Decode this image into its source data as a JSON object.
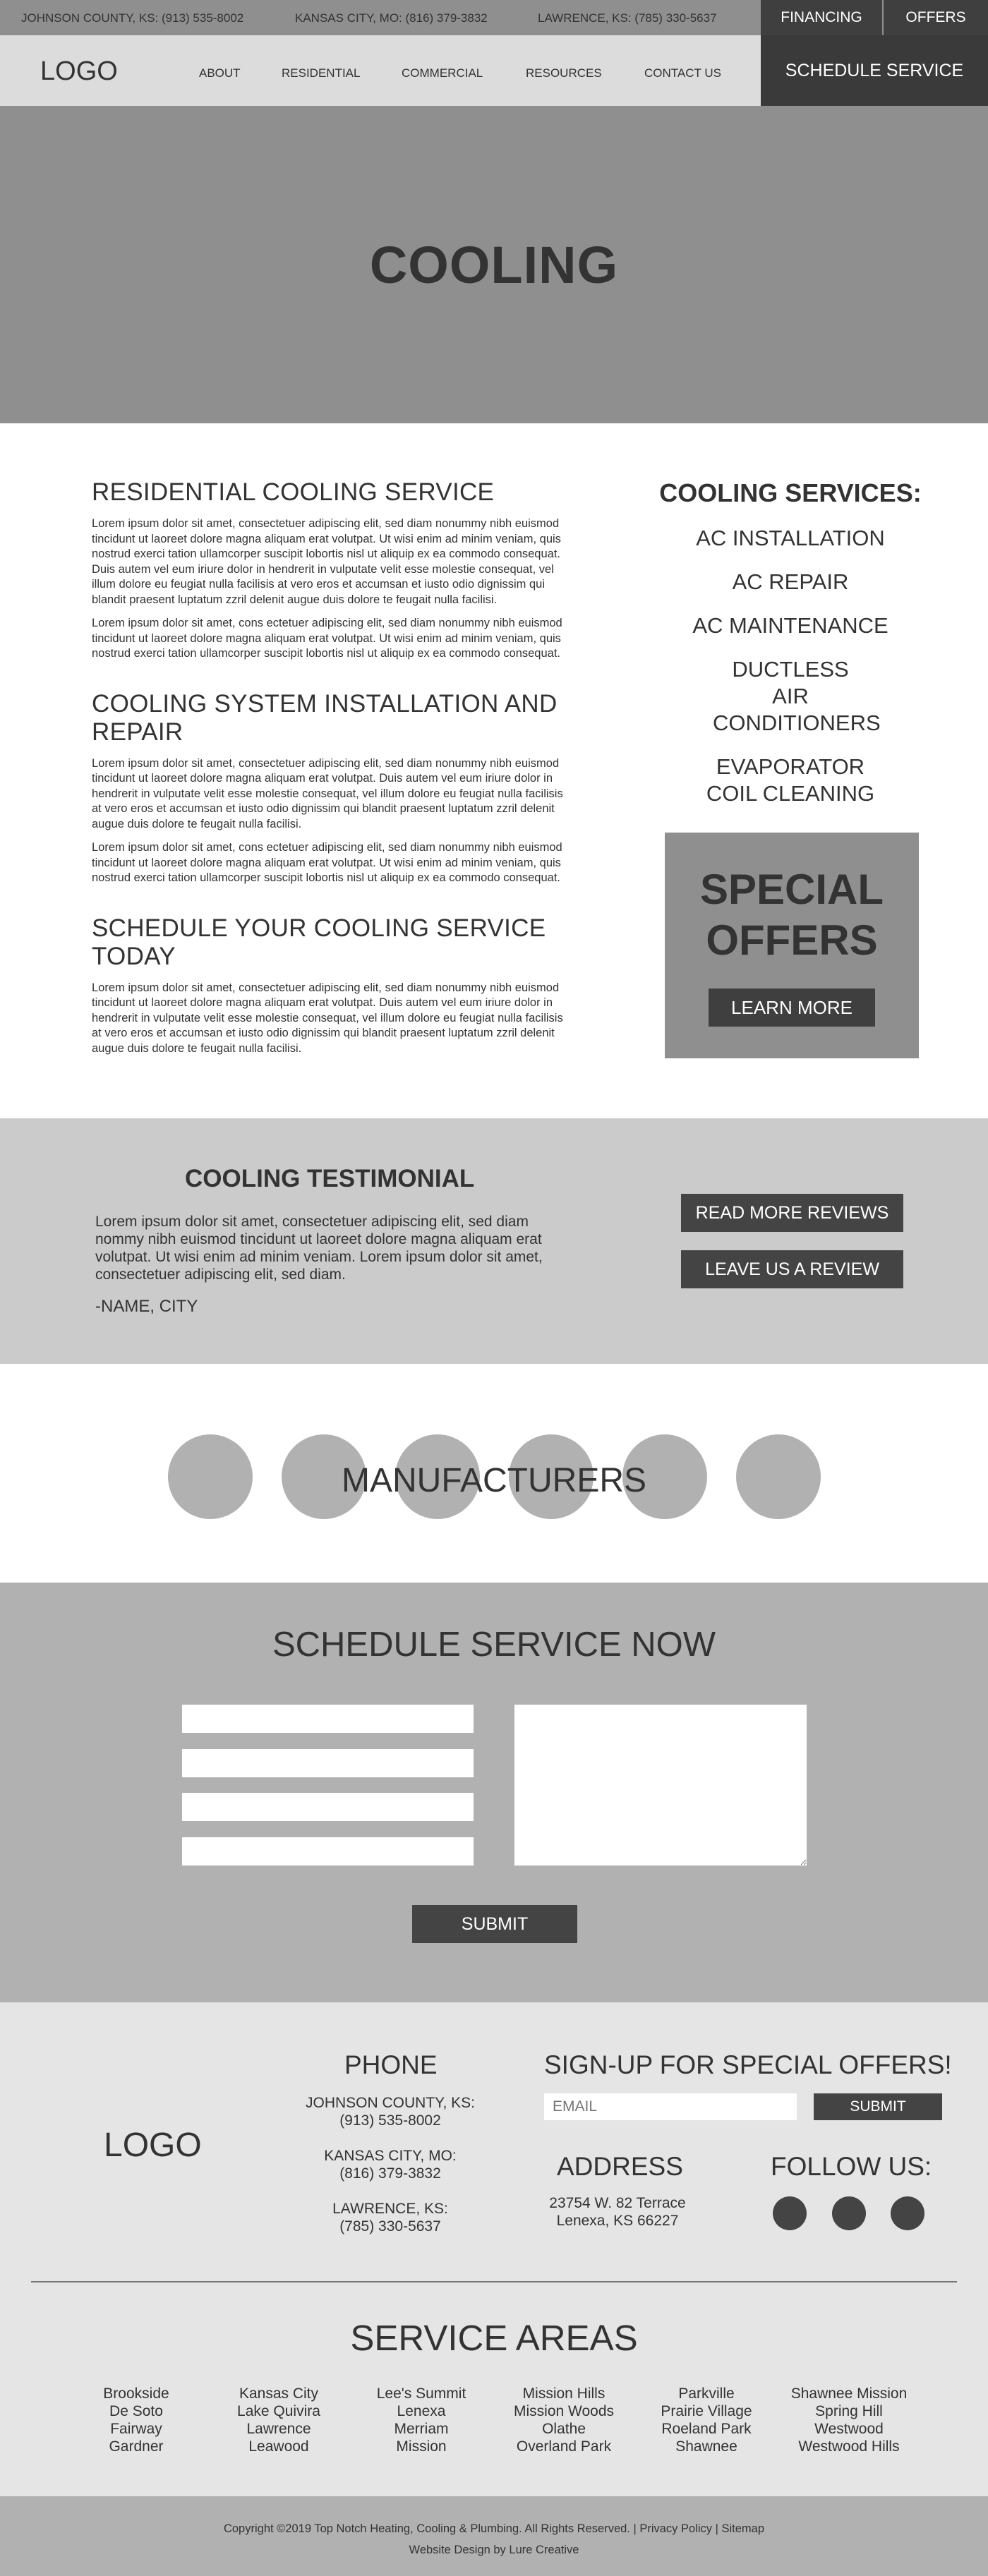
{
  "topbar": {
    "phones": [
      "JOHNSON COUNTY, KS: (913) 535-8002",
      "KANSAS CITY, MO: (816) 379-3832",
      "LAWRENCE, KS: (785) 330-5637"
    ],
    "financing": "FINANCING",
    "offers": "OFFERS"
  },
  "nav": {
    "logo": "LOGO",
    "links": [
      "ABOUT",
      "RESIDENTIAL",
      "COMMERCIAL",
      "RESOURCES",
      "CONTACT US"
    ],
    "schedule": "SCHEDULE SERVICE"
  },
  "hero": {
    "title": "COOLING"
  },
  "content": {
    "h1": "RESIDENTIAL COOLING SERVICE",
    "p1": "Lorem ipsum dolor sit amet, consectetuer adipiscing elit, sed diam nonummy nibh euismod tincidunt ut laoreet dolore magna aliquam erat volutpat. Ut wisi enim ad minim veniam, quis nostrud exerci tation ullamcorper suscipit lobortis nisl ut aliquip ex ea commodo consequat. Duis autem vel eum iriure dolor in hendrerit in vulputate velit esse molestie consequat, vel illum dolore eu feugiat nulla facilisis at vero eros et accumsan et iusto odio dignissim qui blandit praesent luptatum zzril delenit augue duis dolore te feugait nulla facilisi.",
    "p2": "Lorem ipsum dolor sit amet, cons ectetuer adipiscing elit, sed diam nonummy nibh euismod tincidunt ut laoreet dolore magna aliquam erat volutpat. Ut wisi enim ad minim veniam, quis nostrud exerci tation ullamcorper suscipit lobortis nisl ut aliquip ex ea commodo consequat.",
    "h2": "COOLING SYSTEM INSTALLATION AND REPAIR",
    "p3": "Lorem ipsum dolor sit amet, consectetuer adipiscing elit, sed diam nonummy nibh euismod tincidunt ut laoreet dolore magna aliquam erat volutpat. Duis autem vel eum iriure dolor in hendrerit in vulputate velit esse molestie consequat, vel illum dolore eu feugiat nulla facilisis at vero eros et accumsan et iusto odio dignissim qui blandit praesent luptatum zzril delenit augue duis dolore te feugait nulla facilisi.",
    "p4": "Lorem ipsum dolor sit amet, cons ectetuer adipiscing elit, sed diam nonummy nibh euismod tincidunt ut laoreet dolore magna aliquam erat volutpat. Ut wisi enim ad minim veniam, quis nostrud exerci tation ullamcorper suscipit lobortis nisl ut aliquip ex ea commodo consequat.",
    "h3": "SCHEDULE YOUR COOLING SERVICE TODAY",
    "p5": "Lorem ipsum dolor sit amet, consectetuer adipiscing elit, sed diam nonummy nibh euismod tincidunt ut laoreet dolore magna aliquam erat volutpat. Duis autem vel eum iriure dolor in hendrerit in vulputate velit esse molestie consequat, vel illum dolore eu feugiat nulla facilisis at vero eros et accumsan et iusto odio dignissim qui blandit praesent luptatum zzril delenit augue duis dolore te feugait nulla facilisi."
  },
  "sidebar": {
    "title": "COOLING SERVICES:",
    "services": [
      "AC INSTALLATION",
      "AC REPAIR",
      "AC MAINTENANCE",
      "DUCTLESS AIR CONDITIONERS",
      "EVAPORATOR COIL CLEANING"
    ]
  },
  "offers": {
    "line1": "SPECIAL",
    "line2": "OFFERS",
    "button": "LEARN MORE"
  },
  "testimonial": {
    "title": "COOLING TESTIMONIAL",
    "body": "Lorem ipsum dolor sit amet, consectetuer adipiscing elit, sed diam nommy nibh euismod tincidunt ut laoreet dolore magna aliquam erat volutpat. Ut wisi enim ad minim veniam. Lorem ipsum dolor sit amet, consectetuer adipiscing elit, sed diam.",
    "name": "-NAME, CITY",
    "read_more": "READ MORE REVIEWS",
    "leave_review": "LEAVE US A REVIEW"
  },
  "manufacturers": {
    "title": "MANUFACTURERS"
  },
  "schedule": {
    "title": "SCHEDULE SERVICE NOW",
    "submit": "SUBMIT"
  },
  "footer": {
    "logo": "LOGO",
    "phone_title": "PHONE",
    "phones": [
      {
        "label": "JOHNSON COUNTY, KS:",
        "number": "(913) 535-8002"
      },
      {
        "label": "KANSAS CITY, MO:",
        "number": "(816) 379-3832"
      },
      {
        "label": "LAWRENCE, KS:",
        "number": "(785) 330-5637"
      }
    ],
    "signup_title": "SIGN-UP FOR SPECIAL OFFERS!",
    "email_placeholder": "EMAIL",
    "submit": "SUBMIT",
    "address_title": "ADDRESS",
    "address_line1": "23754 W. 82 Terrace",
    "address_line2": "Lenexa, KS 66227",
    "follow_title": "FOLLOW US:",
    "areas_title": "SERVICE AREAS",
    "areas": [
      [
        "Brookside",
        "De Soto",
        "Fairway",
        "Gardner"
      ],
      [
        "Kansas City",
        "Lake Quivira",
        "Lawrence",
        "Leawood"
      ],
      [
        "Lee's Summit",
        "Lenexa",
        "Merriam",
        "Mission"
      ],
      [
        "Mission Hills",
        "Mission Woods",
        "Olathe",
        "Overland Park"
      ],
      [
        "Parkville",
        "Prairie Village",
        "Roeland Park",
        "Shawnee"
      ],
      [
        "Shawnee Mission",
        "Spring Hill",
        "Westwood",
        "Westwood Hills"
      ]
    ]
  },
  "copyright": {
    "line1": "Copyright ©2019 Top Notch Heating, Cooling & Plumbing. All Rights Reserved. | Privacy Policy | Sitemap",
    "line2": "Website Design by Lure Creative"
  }
}
